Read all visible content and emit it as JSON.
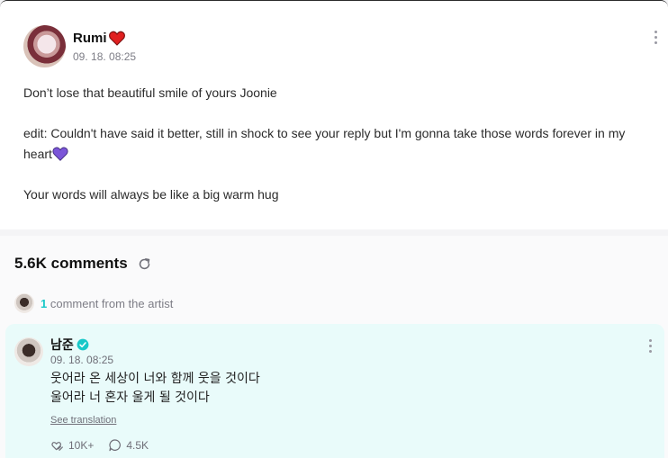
{
  "post": {
    "author": "Rumi",
    "time": "09. 18. 08:25",
    "body": {
      "line1": "Don’t lose that beautiful smile of yours Joonie",
      "line2": "edit: Couldn't have said it better, still in shock to see your reply but I'm gonna take those words forever in my heart",
      "line3": "Your words will always be like a big warm hug"
    }
  },
  "comments": {
    "count_label": "5.6K comments",
    "artist_count": "1",
    "artist_label": "comment from the artist",
    "artist_comment": {
      "author": "남준",
      "time": "09. 18. 08:25",
      "line1": "웃어라 온 세상이 너와 함께 웃을 것이다",
      "line2": "울어라 너 혼자 울게 될 것이다",
      "see_translation": "See translation",
      "likes": "10K+",
      "replies": "4.5K"
    }
  },
  "icons": {
    "heart_red": "heart-icon",
    "heart_purple": "purple-heart-icon",
    "refresh": "refresh-icon",
    "verified": "verified-badge-icon",
    "like": "like-icon",
    "reply": "comment-bubble-icon",
    "more": "more-vertical-icon"
  },
  "colors": {
    "accent": "#18c8c8",
    "heart_red": "#e02020",
    "heart_purple": "#7b55d8",
    "comment_bg": "#e9fbfa"
  }
}
